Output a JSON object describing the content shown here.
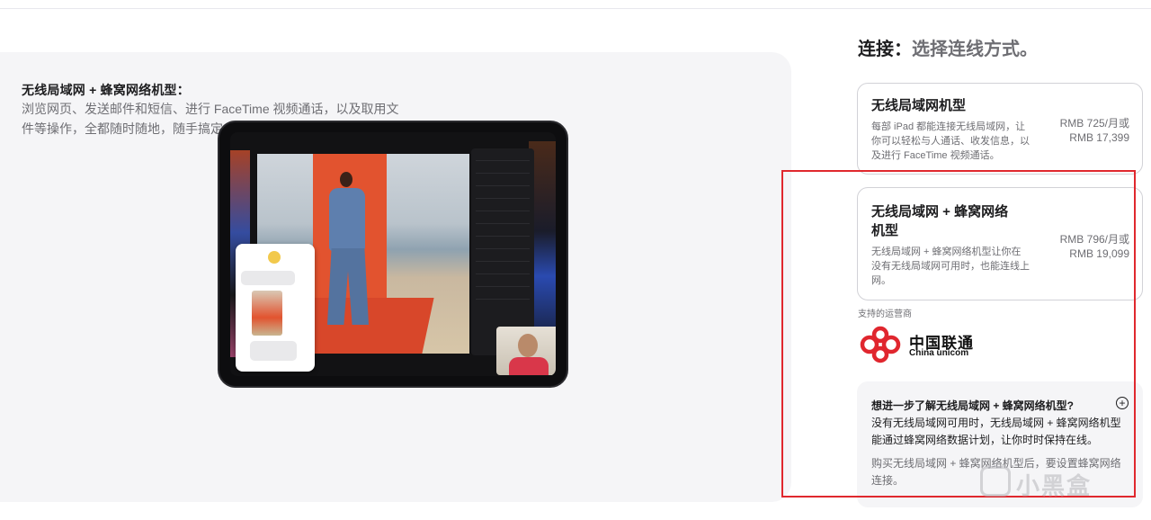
{
  "gallery": {
    "heading": "无线局域网 + 蜂窝网络机型：",
    "body": "浏览网页、发送邮件和短信、进行 FaceTime 视频通话，以及取用文件等操作，全都随时随地，随手搞定。"
  },
  "connectivity": {
    "title": "连接：",
    "subtitle": "选择连线方式。",
    "options": [
      {
        "name": "无线局域网机型",
        "description": "每部 iPad 都能连接无线局域网，让你可以轻松与人通话、收发信息，以及进行 FaceTime 视频通话。",
        "price_monthly": "RMB 725/月或",
        "price_full": "RMB 17,399"
      },
      {
        "name": "无线局域网 + 蜂窝网络机型",
        "description": "无线局域网 + 蜂窝网络机型让你在没有无线局域网可用时，也能连线上网。",
        "price_monthly": "RMB 796/月或",
        "price_full": "RMB 19,099"
      }
    ],
    "carrier_label": "支持的运营商",
    "carrier_name_zh": "中国联通",
    "carrier_name_en": "China unicom",
    "faq": {
      "question": "想进一步了解无线局域网 + 蜂窝网络机型?",
      "answer": "没有无线局域网可用时，无线局域网 + 蜂窝网络机型能通过蜂窝网络数据计划，让你时时保持在线。",
      "note": "购买无线局域网 + 蜂窝网络机型后，要设置蜂窝网络连接。"
    }
  },
  "watermark": "小黑盒",
  "colors": {
    "highlight": "#e0282e",
    "panel_bg": "#f5f5f7",
    "unicom_red": "#e0262e"
  },
  "icons": {
    "faq_toggle": "plus-circle-icon",
    "carrier_logo": "china-unicom-knot-icon"
  }
}
